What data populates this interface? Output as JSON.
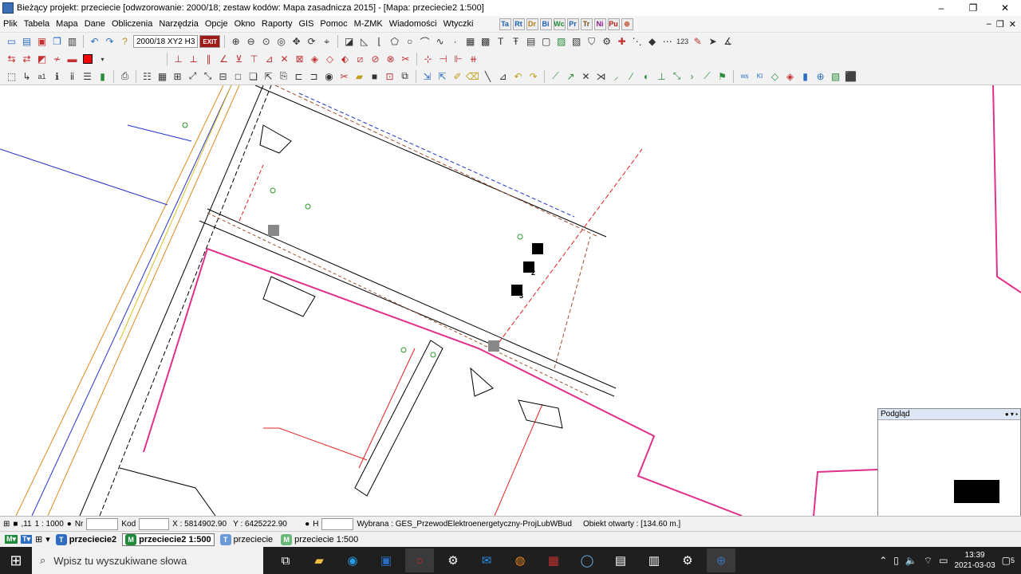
{
  "window": {
    "title": "Bieżący projekt: przeciecie [odwzorowanie: 2000/18; zestaw kodów: Mapa zasadnicza 2015] - [Mapa: przeciecie2  1:500]",
    "minimize": "–",
    "restore": "❐",
    "close": "✕"
  },
  "menu": {
    "items": [
      "Plik",
      "Tabela",
      "Mapa",
      "Dane",
      "Obliczenia",
      "Narzędzia",
      "Opcje",
      "Okno",
      "Raporty",
      "GIS",
      "Pomoc",
      "M-ZMK",
      "Wiadomości",
      "Wtyczki"
    ],
    "modules": [
      "Ta",
      "Rt",
      "Dr",
      "Bi",
      "Wc",
      "Pr",
      "Tr",
      "Ni",
      "Pu"
    ],
    "window_controls": [
      "–",
      "❐",
      "✕"
    ]
  },
  "toolbar1": {
    "coord_system": "2000/18 XY2 H3",
    "exit": "EXIT"
  },
  "statusbar": {
    "layer": ",11",
    "scale": "1 : 1000",
    "nr_label": "Nr",
    "kod_label": "Kod",
    "x": "X : 5814902.90",
    "y": "Y : 6425222.90",
    "h_label": "H",
    "selected": "Wybrana : GES_PrzewodElektroenergetyczny-ProjLubWBud",
    "object": "Obiekt otwarty : [134.60 m.]"
  },
  "tabs": [
    {
      "badge": "T",
      "label": "przeciecie2",
      "active": false,
      "color": "#2d6cc0"
    },
    {
      "badge": "M",
      "label": "przeciecie2  1:500",
      "active": true,
      "color": "#1f8a3a"
    },
    {
      "badge": "T",
      "label": "przeciecie",
      "active": false,
      "color": "#2d6cc0"
    },
    {
      "badge": "M",
      "label": "przeciecie  1:500",
      "active": false,
      "color": "#1f8a3a"
    }
  ],
  "preview": {
    "title": "Podgląd"
  },
  "map": {
    "markers": [
      "1",
      "2",
      "3"
    ],
    "colors": {
      "pink": "#e0308a",
      "red": "#e02020",
      "blue": "#2233cc",
      "orange": "#e08a20",
      "brown": "#a0522d",
      "green": "#2a9a2a"
    }
  },
  "taskbar": {
    "search_placeholder": "Wpisz tu wyszukiwane słowa",
    "time": "13:39",
    "date": "2021-03-03",
    "notifications": "5"
  }
}
